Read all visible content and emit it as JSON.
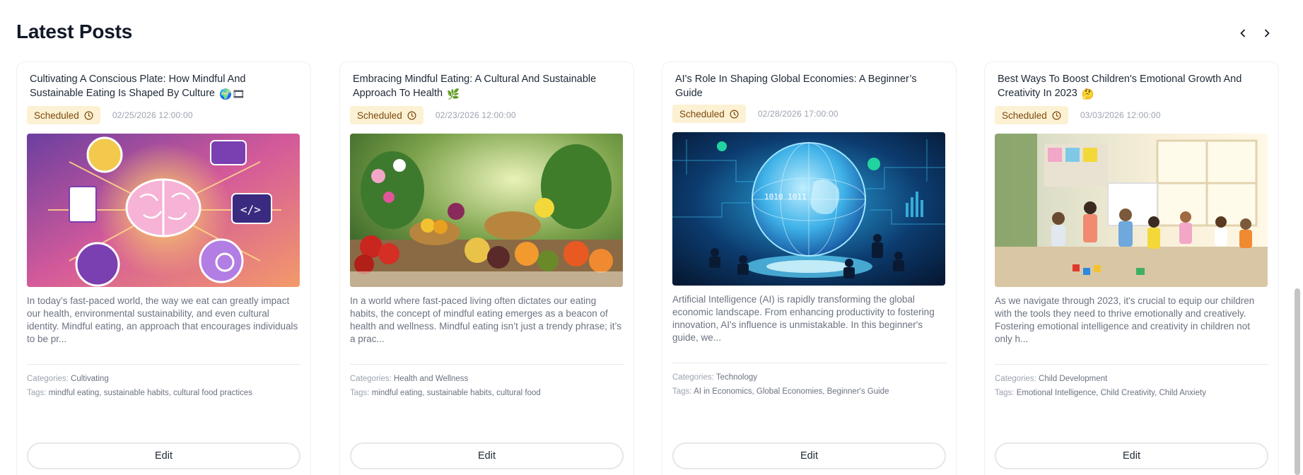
{
  "page": {
    "title": "Latest Posts"
  },
  "nav": {
    "prev_icon": "chevron-left-icon",
    "next_icon": "chevron-right-icon"
  },
  "labels": {
    "categories": "Categories:",
    "tags": "Tags:",
    "edit": "Edit"
  },
  "posts": [
    {
      "title": "Cultivating A Conscious Plate: How Mindful And Sustainable Eating Is Shaped By Culture",
      "title_emoji": "🌍🎞",
      "status": "Scheduled",
      "datetime": "02/25/2026 12:00:00",
      "image": "brain-illustration",
      "excerpt": "In today’s fast-paced world, the way we eat can greatly impact our health, environmental sustainability, and even cultural identity. Mindful eating, an approach that encourages individuals to be pr...",
      "categories": "Cultivating",
      "tags": "mindful eating, sustainable habits, cultural food practices"
    },
    {
      "title": "Embracing Mindful Eating: A Cultural And Sustainable Approach To Health",
      "title_emoji": "🌿",
      "status": "Scheduled",
      "datetime": "02/23/2026 12:00:00",
      "image": "food-market-photo",
      "excerpt": "In a world where fast-paced living often dictates our eating habits, the concept of mindful eating emerges as a beacon of health and wellness. Mindful eating isn’t just a trendy phrase; it’s a prac...",
      "categories": "Health and Wellness",
      "tags": "mindful eating, sustainable habits, cultural food"
    },
    {
      "title": "AI's Role In Shaping Global Economies: A Beginner’s Guide",
      "title_emoji": "",
      "status": "Scheduled",
      "datetime": "02/28/2026 17:00:00",
      "image": "digital-globe-illustration",
      "excerpt": "Artificial Intelligence (AI) is rapidly transforming the global economic landscape. From enhancing productivity to fostering innovation, AI's influence is unmistakable. In this beginner's guide, we...",
      "categories": "Technology",
      "tags": "AI in Economics, Global Economies, Beginner's Guide"
    },
    {
      "title": "Best Ways To Boost Children's Emotional Growth And Creativity In 2023",
      "title_emoji": "🤔",
      "status": "Scheduled",
      "datetime": "03/03/2026 12:00:00",
      "image": "classroom-children-photo",
      "excerpt": "As we navigate through 2023, it's crucial to equip our children with the tools they need to thrive emotionally and creatively. Fostering emotional intelligence and creativity in children not only h...",
      "categories": "Child Development",
      "tags": "Emotional Intelligence, Child Creativity, Child Anxiety"
    }
  ],
  "colors": {
    "badge_bg": "#fdf1d3",
    "badge_text": "#7a4a10",
    "border": "#e5e7eb"
  }
}
